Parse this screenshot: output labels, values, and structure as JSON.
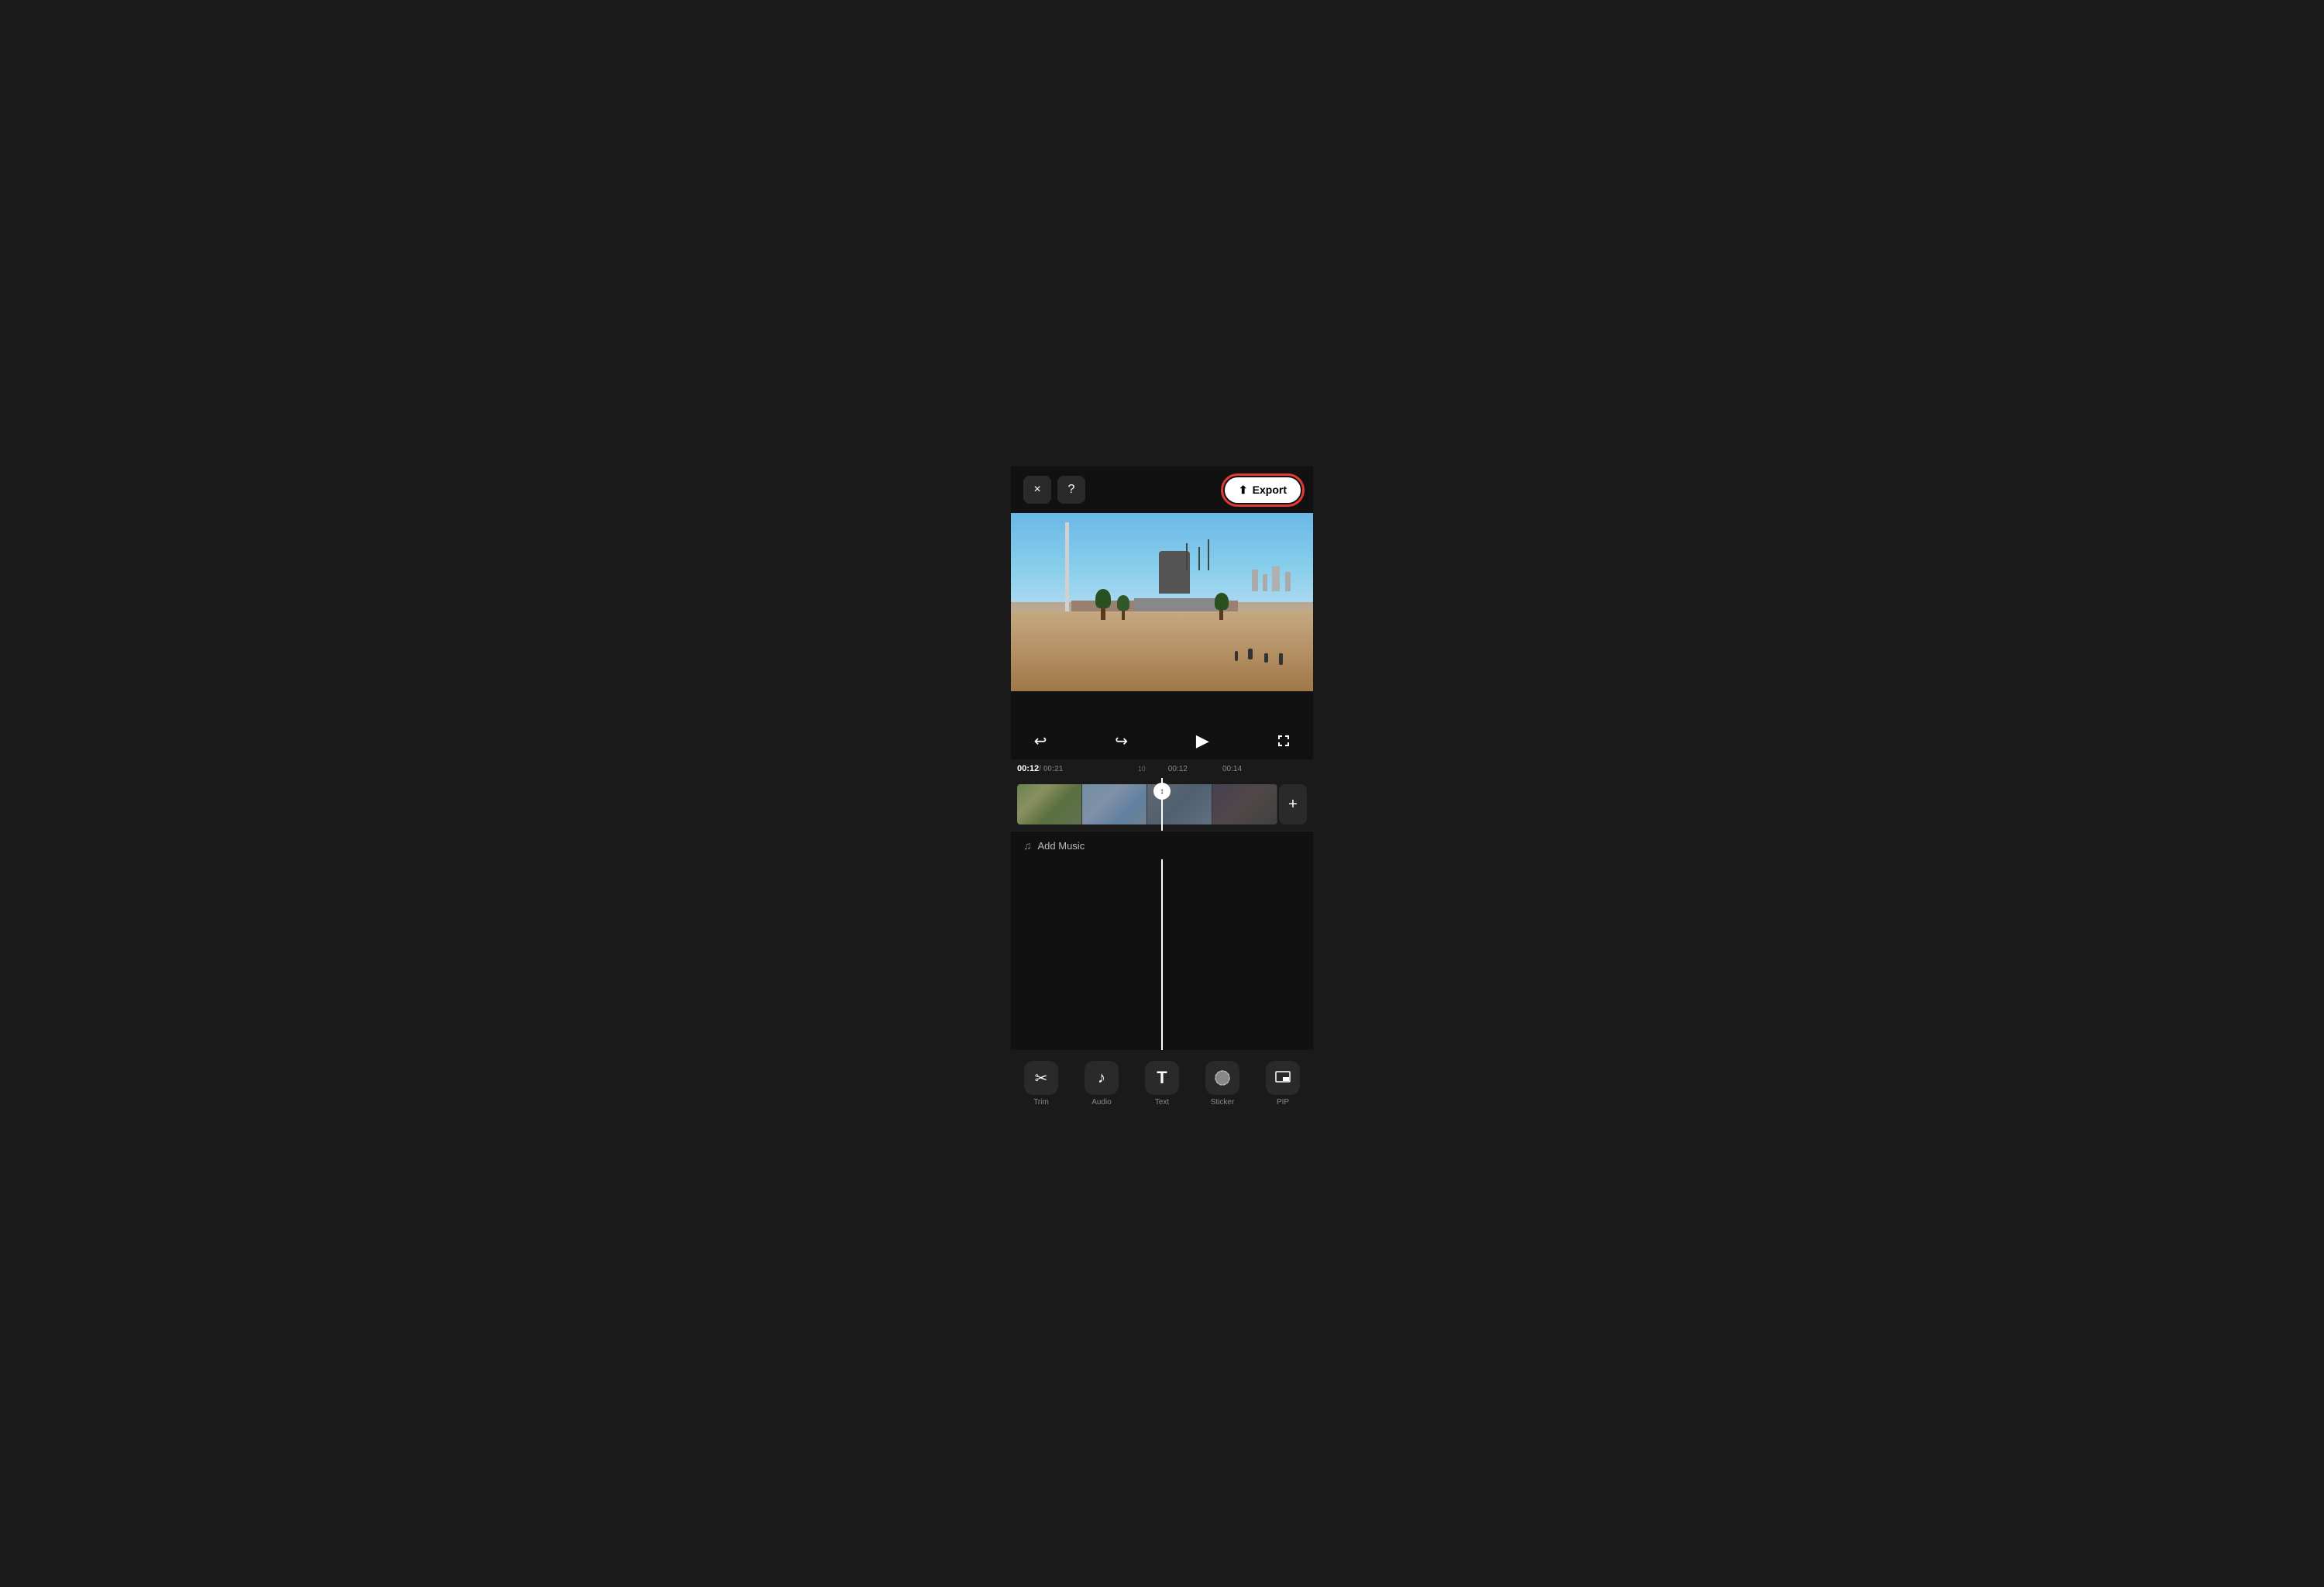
{
  "header": {
    "close_label": "×",
    "help_label": "?",
    "export_label": "Export"
  },
  "controls": {
    "undo_label": "↩",
    "redo_label": "↪",
    "play_label": "▶",
    "fullscreen_label": "⛶"
  },
  "timeline": {
    "current_time": "00:12",
    "total_time": "/ 00:21",
    "marker_10": "10",
    "marker_12": "00:12",
    "marker_14": "00:14"
  },
  "add_music": {
    "label": "Add Music"
  },
  "toolbar": {
    "items": [
      {
        "id": "trim",
        "icon": "✂",
        "label": "Trim"
      },
      {
        "id": "audio",
        "icon": "♪",
        "label": "Audio"
      },
      {
        "id": "text",
        "icon": "T",
        "label": "Text"
      },
      {
        "id": "sticker",
        "icon": "◕",
        "label": "Sticker"
      },
      {
        "id": "pip",
        "icon": "⊞",
        "label": "PIP"
      }
    ]
  },
  "playhead": {
    "icon": "↕"
  },
  "add_clip": {
    "icon": "+"
  },
  "colors": {
    "export_outline": "#e53935",
    "bg": "#000000",
    "header_bg": "#111111",
    "timeline_bg": "#1a1a1a",
    "tool_bg": "#2a2a2a",
    "playhead_color": "#ffffff"
  }
}
